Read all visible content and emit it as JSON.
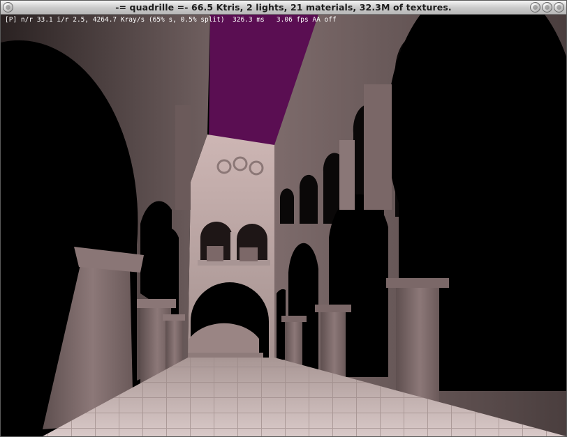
{
  "window": {
    "title": "-= quadrille =-  66.5 Ktris, 2 lights, 21 materials, 32.3M of textures."
  },
  "overlay": {
    "stats_line": "[P] n/r 33.1 i/r 2.5, 4264.7 Kray/s (65% s, 0.5% split)  326.3 ms   3.06 fps AA off"
  },
  "colors": {
    "sky": "#5a0e52",
    "stone": "#857272",
    "floor": "#c9b8b6",
    "background": "#000000"
  }
}
